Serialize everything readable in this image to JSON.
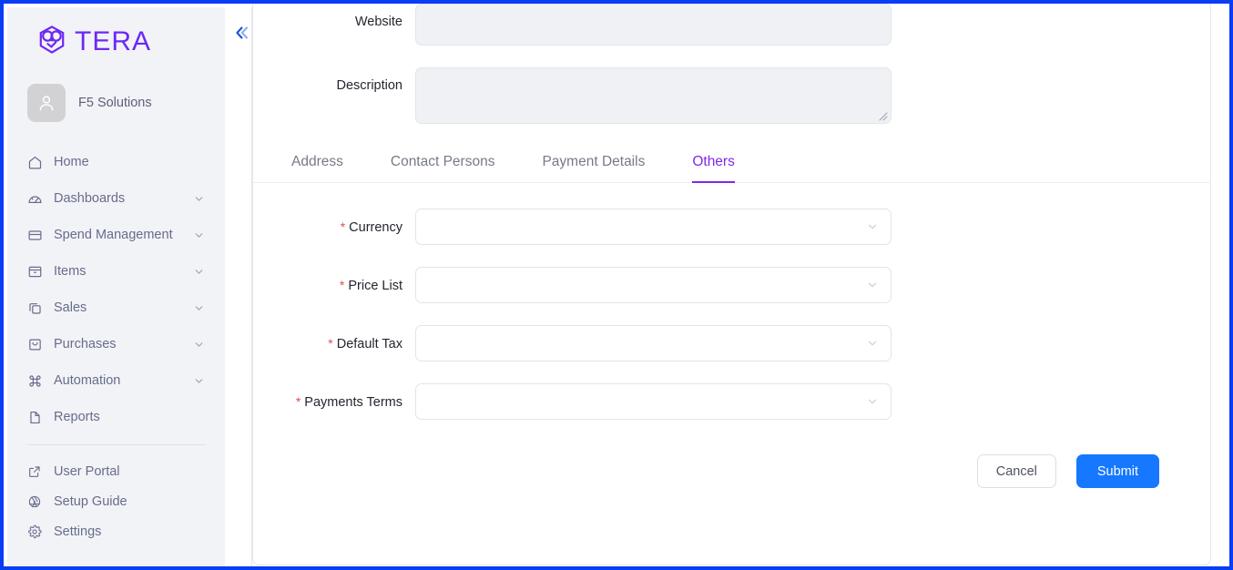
{
  "brand": {
    "logo_icon": "tera-hex-logo-icon",
    "name": "TERA",
    "color": "#6d28f5"
  },
  "sidebar": {
    "profile": {
      "avatar_icon": "user-avatar-icon",
      "name": "F5 Solutions"
    },
    "collapse_icon": "double-chevron-left-icon",
    "items": [
      {
        "label": "Home",
        "icon": "home-icon",
        "caret": false
      },
      {
        "label": "Dashboards",
        "icon": "dashboard-gauge-icon",
        "caret": true
      },
      {
        "label": "Spend Management",
        "icon": "credit-card-icon",
        "caret": true
      },
      {
        "label": "Items",
        "icon": "box-archive-icon",
        "caret": true
      },
      {
        "label": "Sales",
        "icon": "copy-stack-icon",
        "caret": true
      },
      {
        "label": "Purchases",
        "icon": "shopping-bag-icon",
        "caret": true
      },
      {
        "label": "Automation",
        "icon": "command-key-icon",
        "caret": true
      },
      {
        "label": "Reports",
        "icon": "file-page-icon",
        "caret": false
      }
    ],
    "bottom_items": [
      {
        "label": "User Portal",
        "icon": "external-link-icon"
      },
      {
        "label": "Setup Guide",
        "icon": "aperture-icon"
      },
      {
        "label": "Settings",
        "icon": "gear-icon"
      }
    ]
  },
  "form": {
    "website": {
      "label": "Website",
      "value": "",
      "placeholder": ""
    },
    "description": {
      "label": "Description",
      "value": "",
      "placeholder": "",
      "resize_icon": "resize-grip-icon"
    }
  },
  "tabs": {
    "active": "Others",
    "items": [
      {
        "label": "Address"
      },
      {
        "label": "Contact Persons"
      },
      {
        "label": "Payment Details"
      },
      {
        "label": "Others"
      }
    ]
  },
  "others_panel": {
    "fields": [
      {
        "label": "Currency",
        "required": true,
        "value": "",
        "placeholder": "",
        "caret_icon": "chevron-down-icon"
      },
      {
        "label": "Price List",
        "required": true,
        "value": "",
        "placeholder": "",
        "caret_icon": "chevron-down-icon"
      },
      {
        "label": "Default Tax",
        "required": true,
        "value": "",
        "placeholder": "",
        "caret_icon": "chevron-down-icon"
      },
      {
        "label": "Payments Terms",
        "required": true,
        "value": "",
        "placeholder": "",
        "caret_icon": "chevron-down-icon"
      }
    ]
  },
  "actions": {
    "cancel_label": "Cancel",
    "submit_label": "Submit",
    "submit_color": "#1677ff"
  },
  "colors": {
    "frame_border": "#0b3df5",
    "sidebar_bg": "#f2f3f7",
    "accent_purple": "#7d2ae8",
    "required_star": "#e0504f",
    "input_fill": "#f0f1f5"
  }
}
